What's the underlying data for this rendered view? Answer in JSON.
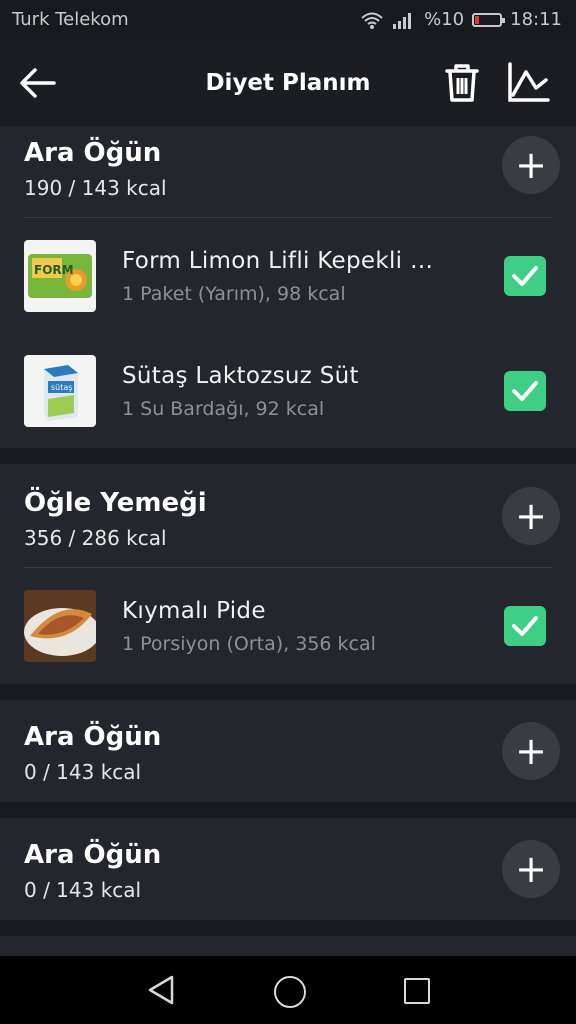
{
  "status_bar": {
    "carrier": "Turk Telekom",
    "battery_text": "%10",
    "time": "18:11",
    "battery_level": 0.1
  },
  "app_bar": {
    "title": "Diyet Planım",
    "back_icon": "arrow-left-icon",
    "delete_icon": "trash-icon",
    "chart_icon": "line-chart-icon"
  },
  "meals": [
    {
      "name": "Ara Öğün",
      "kcal": "190 / 143 kcal",
      "items": [
        {
          "name": "Form Limon Lifli Kepekli …",
          "detail": "1 Paket (Yarım), 98 kcal",
          "checked": true,
          "thumb_text": "FORM"
        },
        {
          "name": "Sütaş Laktozsuz Süt",
          "detail": "1 Su Bardağı, 92 kcal",
          "checked": true,
          "thumb_text": "sütaş"
        }
      ]
    },
    {
      "name": "Öğle Yemeği",
      "kcal": "356 / 286 kcal",
      "items": [
        {
          "name": "Kıymalı Pide",
          "detail": "1 Porsiyon (Orta), 356 kcal",
          "checked": true
        }
      ]
    },
    {
      "name": "Ara Öğün",
      "kcal": "0 / 143 kcal",
      "items": []
    },
    {
      "name": "Ara Öğün",
      "kcal": "0 / 143 kcal",
      "items": []
    }
  ],
  "add_label": "+",
  "colors": {
    "background": "#191a1f",
    "card": "#24262d",
    "check": "#3fcf84",
    "add_button": "#3a3c43"
  }
}
